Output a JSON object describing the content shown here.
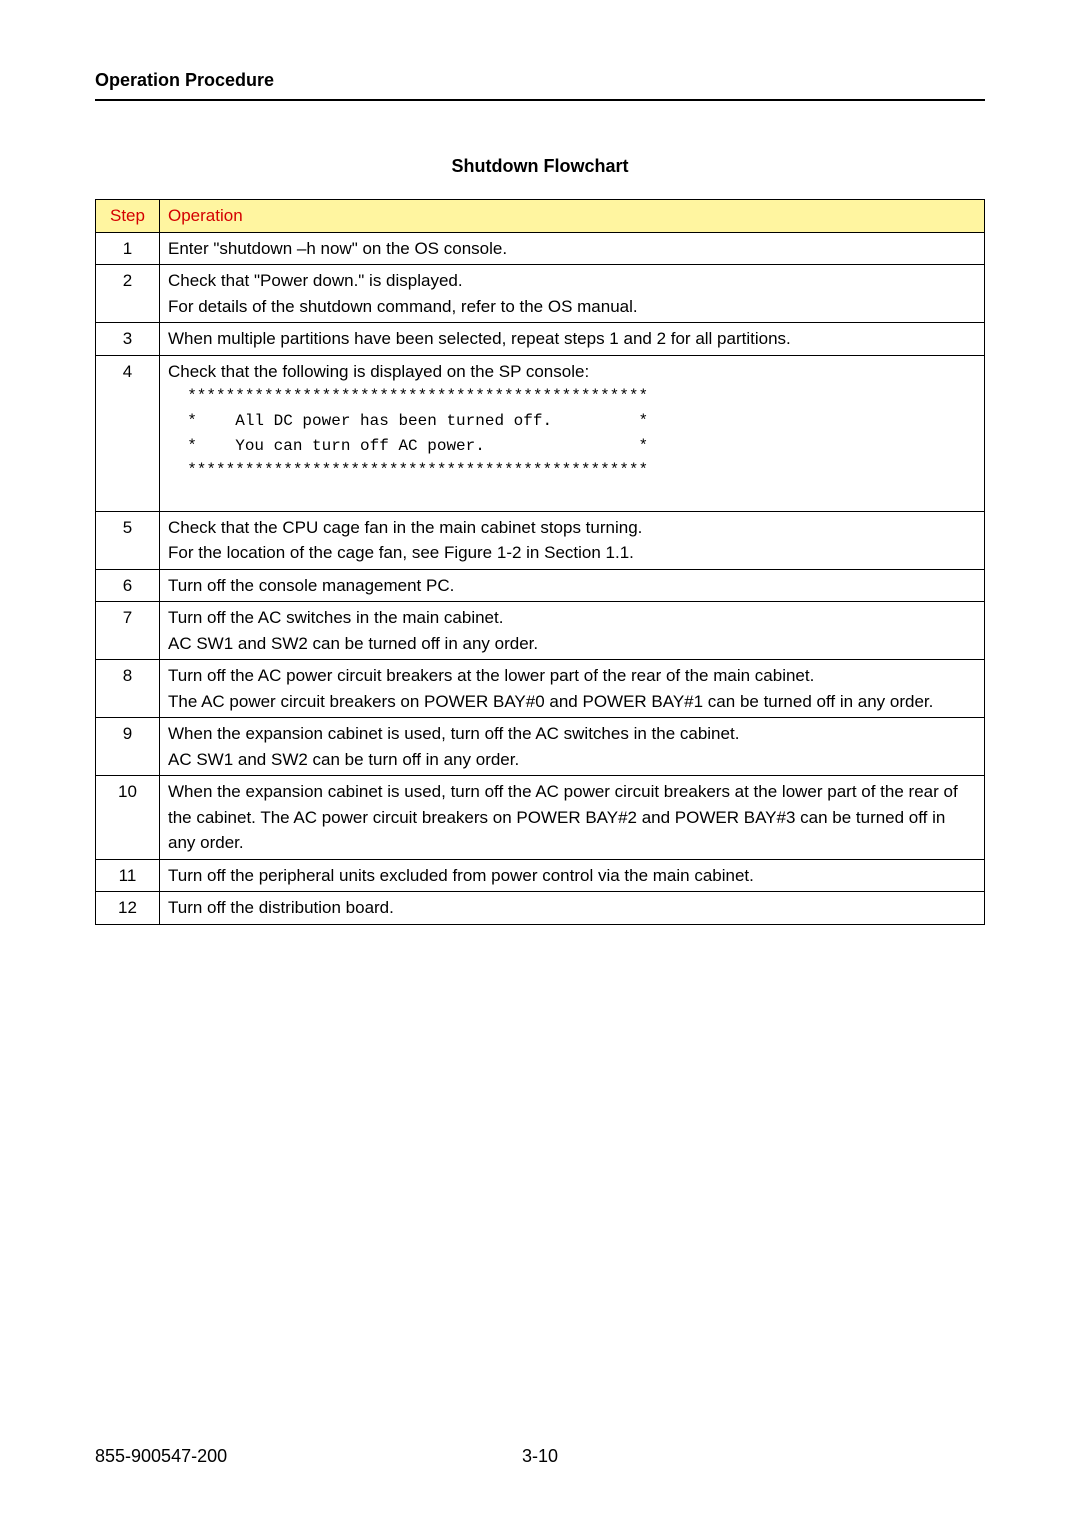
{
  "header": "Operation Procedure",
  "title": "Shutdown Flowchart",
  "table": {
    "head": {
      "step": "Step",
      "operation": "Operation"
    },
    "rows": [
      {
        "step": "1",
        "op": "Enter \"shutdown –h now\" on the OS console."
      },
      {
        "step": "2",
        "op_line1": "Check that \"Power down.\" is displayed.",
        "op_line2": "For details of the shutdown command, refer to the OS manual."
      },
      {
        "step": "3",
        "op": "When multiple partitions have been selected, repeat steps 1 and 2 for all partitions."
      },
      {
        "step": "4",
        "op_line1": "Check that the following is displayed on the SP console:",
        "mono1": "  ************************************************",
        "mono2": "  *    All DC power has been turned off.         *",
        "mono3": "  *    You can turn off AC power.                *",
        "mono4": "  ************************************************",
        "mono5": " "
      },
      {
        "step": "5",
        "op_line1": "Check that the CPU cage fan in the main cabinet stops turning.",
        "op_line2": "For the location of the cage fan, see Figure 1-2 in Section 1.1."
      },
      {
        "step": "6",
        "op": "Turn off the console management PC."
      },
      {
        "step": "7",
        "op_line1": "Turn off the AC switches in the main cabinet.",
        "op_line2": "AC SW1 and SW2 can be turned off in any order."
      },
      {
        "step": "8",
        "op_line1": "Turn off the AC power circuit breakers at the lower part of the rear of the main cabinet.",
        "op_line2": "The AC power circuit breakers on POWER BAY#0 and POWER BAY#1 can be turned off in any order."
      },
      {
        "step": "9",
        "op_line1": "When the expansion cabinet is used, turn off the AC switches in the cabinet.",
        "op_line2": "AC SW1 and SW2 can be turn off in any order."
      },
      {
        "step": "10",
        "op": "When the expansion cabinet is used, turn off the AC power circuit breakers at the lower part of the rear of the cabinet. The AC power circuit breakers on POWER BAY#2 and POWER BAY#3 can be turned off in any order."
      },
      {
        "step": "11",
        "op": "Turn off the peripheral units excluded from power control via the main cabinet."
      },
      {
        "step": "12",
        "op": "Turn off the distribution board."
      }
    ]
  },
  "footer": {
    "doc_number": "855-900547-200",
    "page_number": "3-10"
  }
}
